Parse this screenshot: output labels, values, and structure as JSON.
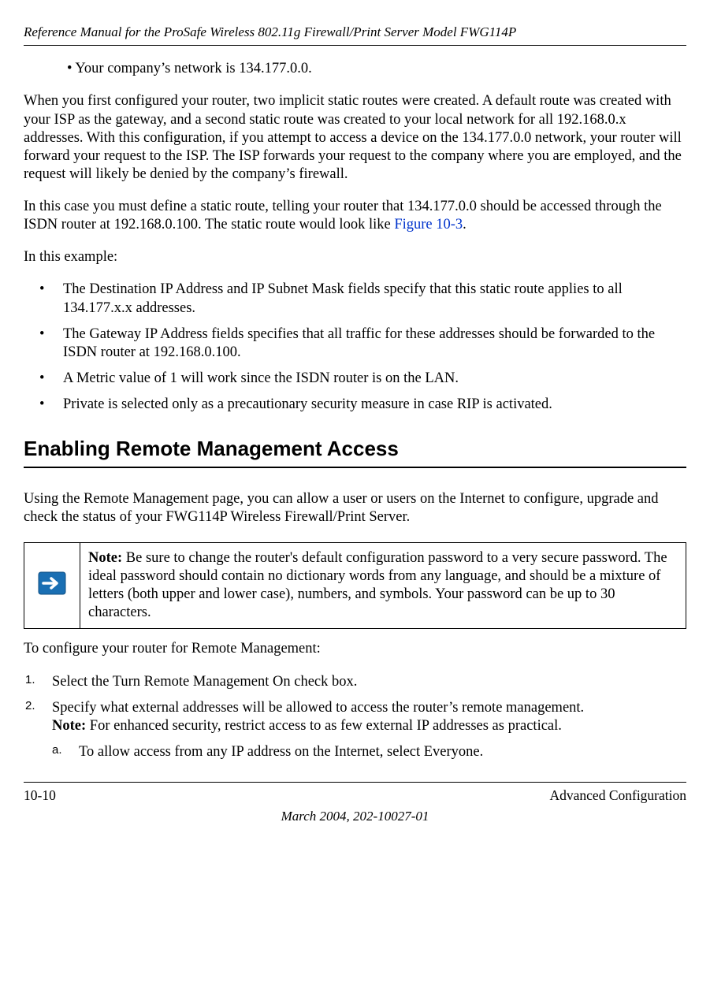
{
  "header": {
    "title": "Reference Manual for the ProSafe Wireless 802.11g  Firewall/Print Server Model FWG114P"
  },
  "bullet_intro": "•      Your company’s network is 134.177.0.0.",
  "para1": "When you first configured your router, two implicit static routes were created. A default route was created with your ISP as the gateway, and a second static route was created to your local network for all 192.168.0.x addresses. With this configuration, if you attempt to access a device on the 134.177.0.0 network, your router will forward your request to the ISP. The ISP forwards your request to the company where you are employed, and the request will likely be denied by the company’s firewall.",
  "para2_pre": "In this case you must define a static route, telling your router that 134.177.0.0 should be accessed through the ISDN router at 192.168.0.100. The static route would look like ",
  "para2_link": "Figure 10-3",
  "para2_post": ".",
  "para3": "In this example:",
  "bullets": [
    "The Destination IP Address and IP Subnet Mask fields specify that this static route applies to all 134.177.x.x addresses.",
    "The Gateway IP Address fields specifies that all traffic for these addresses should be forwarded to the ISDN router at 192.168.0.100.",
    "A Metric value of 1 will work since the ISDN router is on the LAN.",
    "Private is selected only as a precautionary security measure in case RIP is activated."
  ],
  "section_heading": "Enabling Remote Management Access",
  "para4": "Using the Remote Management page, you can allow a user or users on the Internet to configure, upgrade and check the status of your FWG114P Wireless Firewall/Print Server.",
  "note": {
    "label": "Note:",
    "text": " Be sure to change the router's default configuration password to a very secure password. The ideal password should contain no dictionary words from any language, and should be a mixture of letters (both upper and lower case), numbers, and symbols. Your password can be up to 30 characters."
  },
  "para5": "To configure your router for Remote Management:",
  "steps": [
    {
      "num": "1.",
      "text": "Select the Turn Remote Management On check box."
    },
    {
      "num": "2.",
      "text_pre": "Specify what external addresses will be allowed to access the router’s remote management.",
      "note_label": "Note:",
      "note_text": " For enhanced security, restrict access to as few external IP addresses as practical.",
      "sub": {
        "num": "a.",
        "text": "To allow access from any IP address on the Internet, select Everyone."
      }
    }
  ],
  "footer": {
    "left": "10-10",
    "right": "Advanced Configuration",
    "center": "March 2004, 202-10027-01"
  }
}
